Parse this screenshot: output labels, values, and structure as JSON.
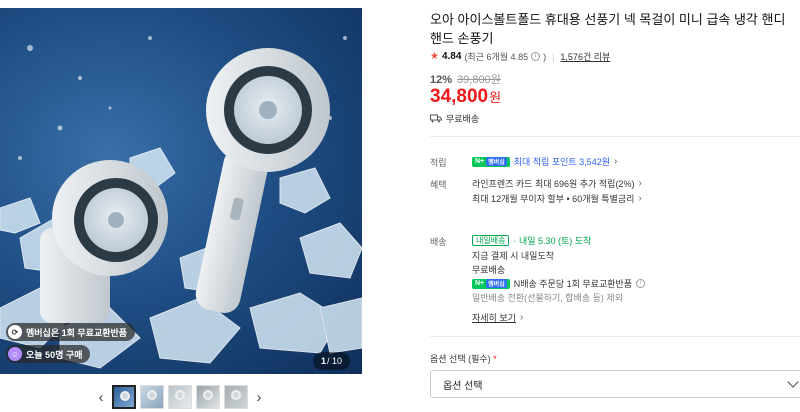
{
  "gallery": {
    "badge_membership": "멤버십은 1회 무료교환반품",
    "badge_purchases": "오늘 50명 구매",
    "counter_current": "1",
    "counter_total": "/ 10",
    "prev_arrow": "‹",
    "next_arrow": "›",
    "thumbnails": [
      "thumb-1",
      "thumb-2",
      "thumb-3",
      "thumb-4",
      "thumb-5"
    ]
  },
  "product": {
    "title": "오아 아이스볼트폴드 휴대용 선풍기 넥 목걸이 미니 급속 냉각 핸디 핸드 손풍기",
    "rating_score": "4.84",
    "rating_recent": "(최근 6개월 4.85",
    "rating_recent_close": ")",
    "review_count": "1,576건 리뷰",
    "discount_pct": "12%",
    "original_price": "39,800원",
    "price_num": "34,800",
    "price_unit": "원",
    "shipping": "무료배송"
  },
  "benefits": {
    "points_label": "적립",
    "npay_label": "N+",
    "npay_member": "멤버십",
    "points_text": "최대 적립 포인트 3,542원",
    "benefit_label": "혜택",
    "card_text": "라인프렌즈 카드 최대 696원 추가 적립(2%)",
    "installment_text": "최대 12개월 무이자 할부 • 60개월 특별금리"
  },
  "delivery": {
    "label": "배송",
    "tomorrow_badge": "내일배송",
    "arrival": "· 내일 5.30 (토) 도착",
    "pay_now": "지금 결제 시 내일도착",
    "free_shipping": "무료배송",
    "npay_return": "N배송 주문당 1회 무료교환반품",
    "general_return": "일반배송 전환(선물하기, 합배송 등) 제외",
    "details_link": "자세히 보기"
  },
  "options": {
    "label": "옵션 선택 (필수)",
    "required_mark": "*",
    "select_value": "옵션 선택"
  },
  "colors": {
    "price_red": "#f01a1a",
    "naver_green": "#03c75a",
    "link_blue": "#2d5ef5"
  }
}
